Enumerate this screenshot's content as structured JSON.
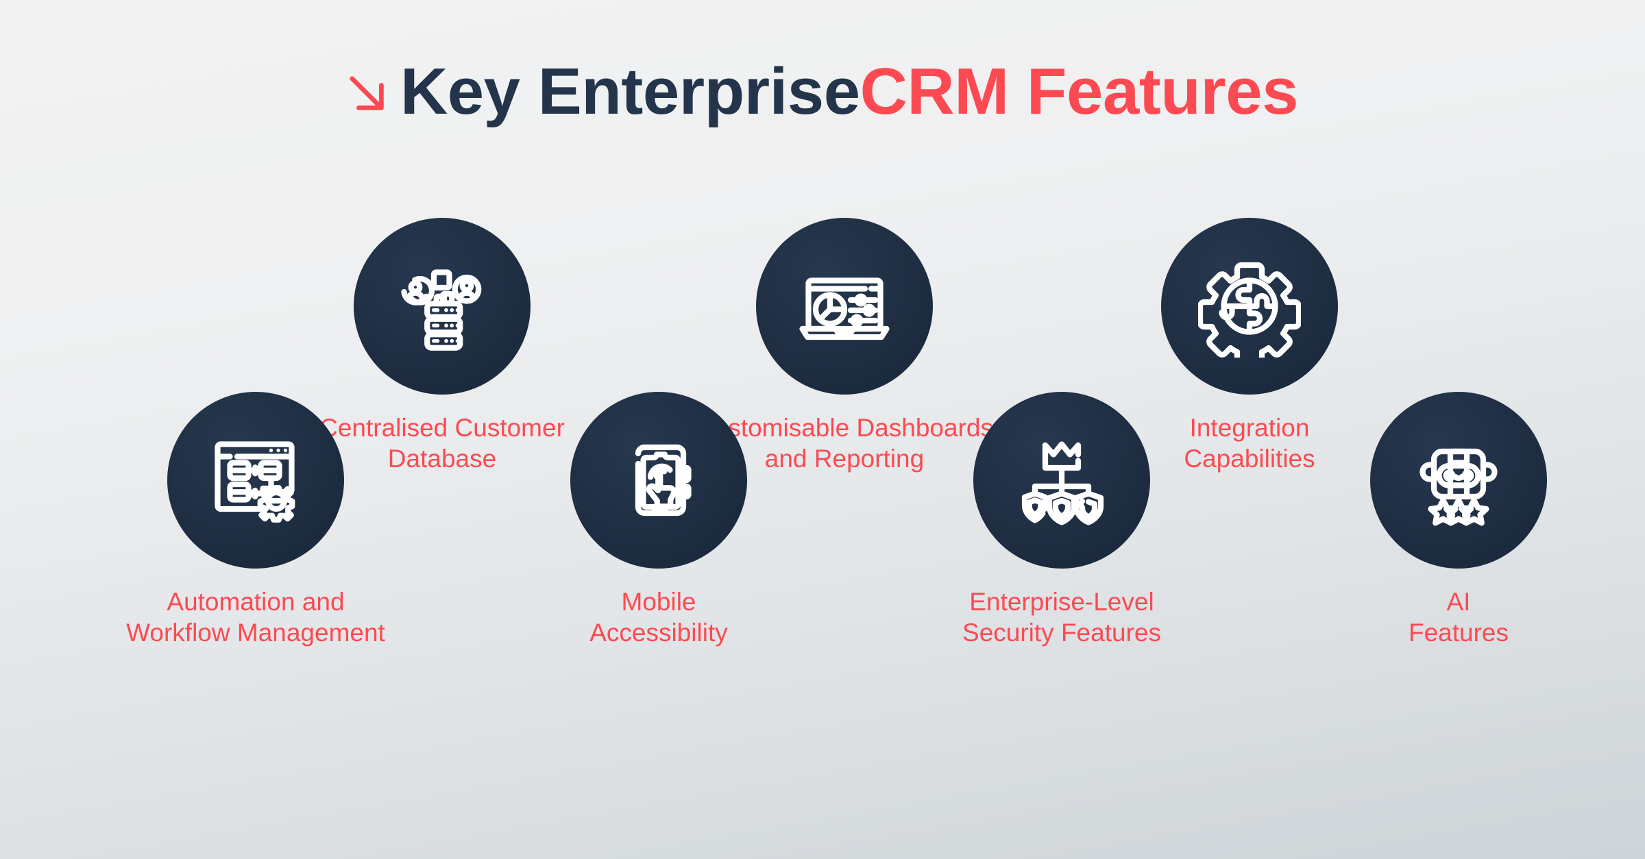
{
  "title": {
    "arrow_icon": "arrow-down-right-icon",
    "part_dark": "Key Enterprise ",
    "part_accent": "CRM Features"
  },
  "colors": {
    "accent": "#fc4a52",
    "title_dark": "#23344b",
    "circle_navy": "#1f2e42",
    "icon_stroke": "#ffffff",
    "bg_light": "#f2f2f2",
    "bg_dark": "#ced4d8"
  },
  "features": [
    {
      "id": "centralised-customer-database",
      "icon": "server-database-users-icon",
      "label": "Centralised Customer\nDatabase"
    },
    {
      "id": "customisable-dashboards-and-reporting",
      "icon": "laptop-dashboard-chart-icon",
      "label": "Customisable Dashboards\nand Reporting"
    },
    {
      "id": "integration-capabilities",
      "icon": "gear-puzzle-icon",
      "label": "Integration\nCapabilities"
    },
    {
      "id": "automation-and-workflow-management",
      "icon": "browser-workflow-gear-icon",
      "label": "Automation and\nWorkflow Management"
    },
    {
      "id": "mobile-accessibility",
      "icon": "smartphone-tap-hand-icon",
      "label": "Mobile\nAccessibility"
    },
    {
      "id": "enterprise-level-security-features",
      "icon": "crown-hierarchy-shields-icon",
      "label": "Enterprise-Level\nSecurity Features"
    },
    {
      "id": "ai-features",
      "icon": "robot-stars-icon",
      "label": "AI\nFeatures"
    }
  ]
}
